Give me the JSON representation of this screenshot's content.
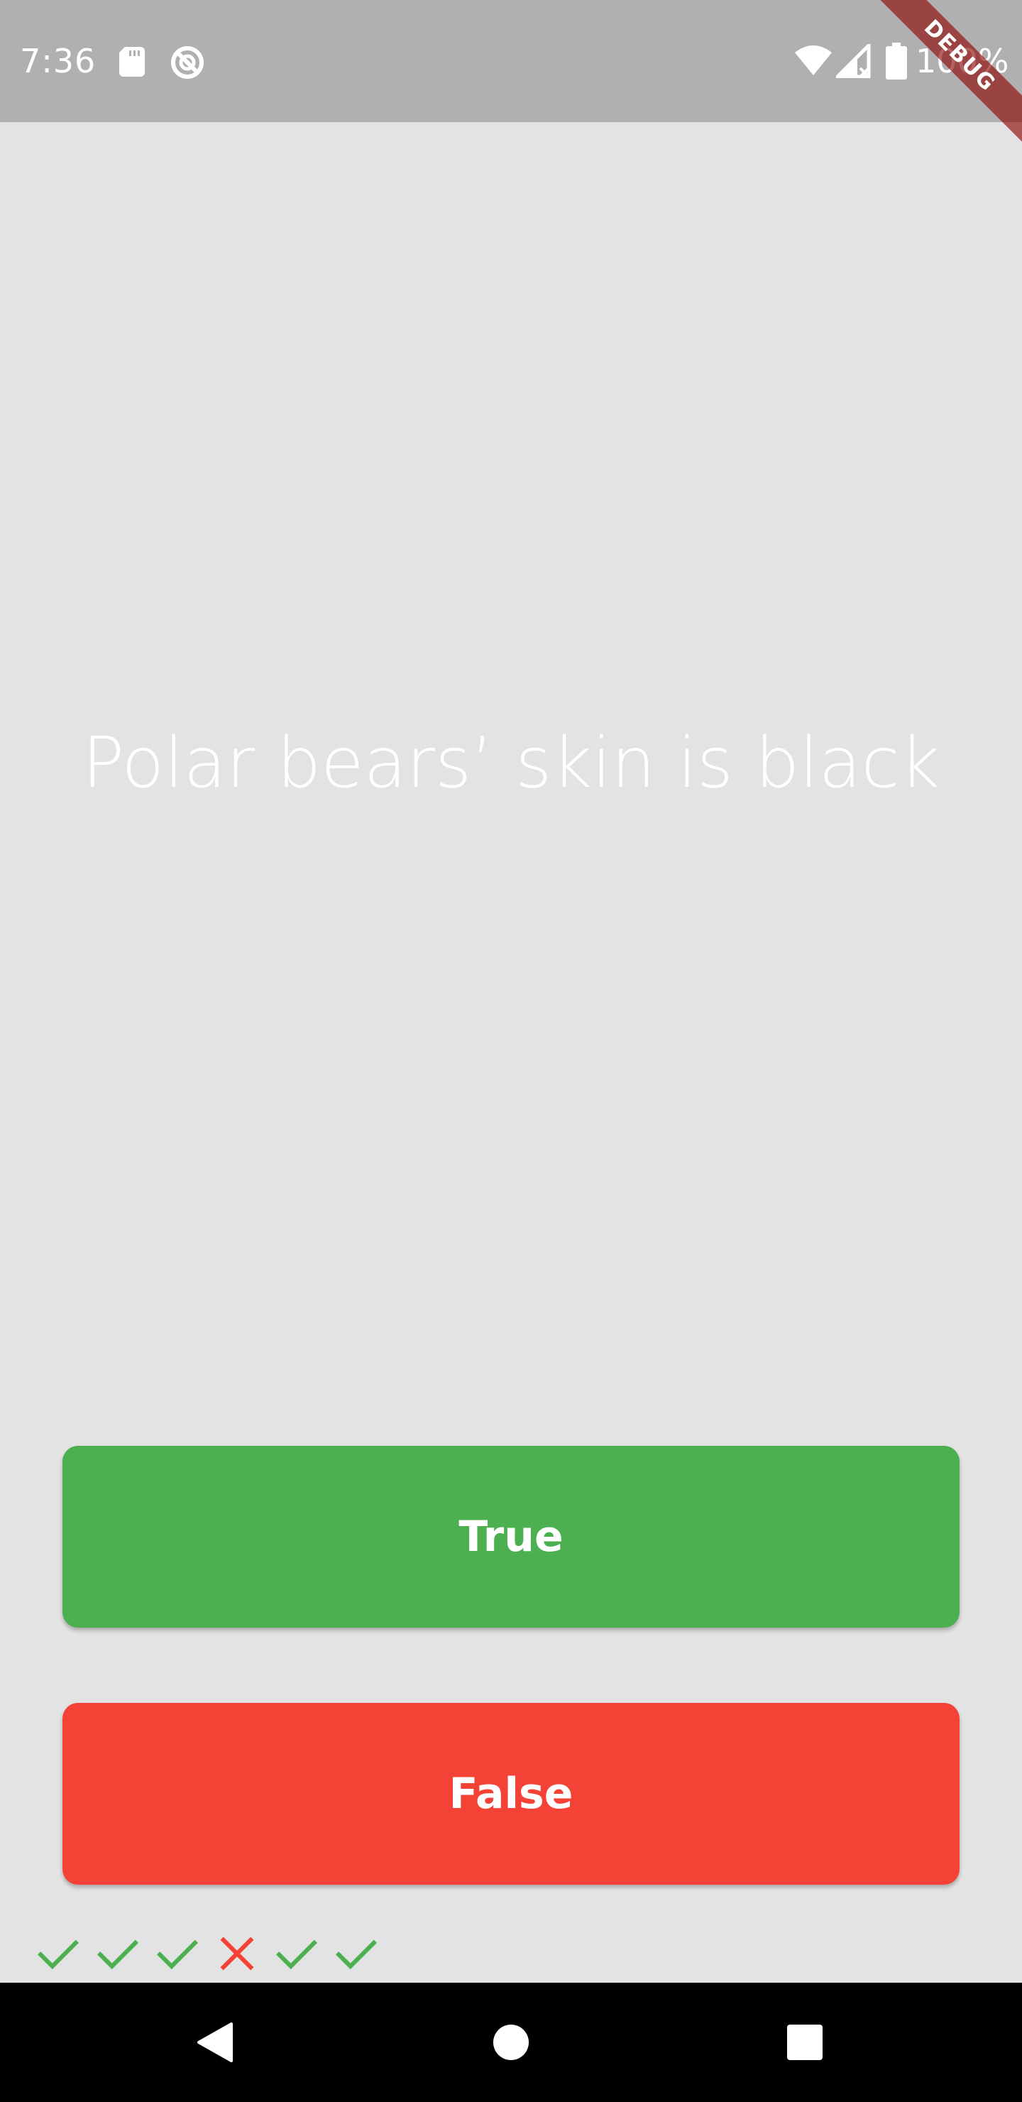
{
  "status_bar": {
    "time": "7:36",
    "battery": "100%",
    "icons": [
      "sd-card-icon",
      "sync-off-icon",
      "wifi-icon",
      "signal-icon",
      "battery-icon"
    ]
  },
  "debug_banner": "DEBUG",
  "question": {
    "text": "Polar bears’ skin is black"
  },
  "buttons": {
    "true_label": "True",
    "false_label": "False"
  },
  "score_keeper": [
    {
      "result": "correct",
      "icon": "check-icon"
    },
    {
      "result": "correct",
      "icon": "check-icon"
    },
    {
      "result": "correct",
      "icon": "check-icon"
    },
    {
      "result": "wrong",
      "icon": "close-icon"
    },
    {
      "result": "correct",
      "icon": "check-icon"
    },
    {
      "result": "correct",
      "icon": "check-icon"
    }
  ],
  "nav_bar": {
    "icons": [
      "back-icon",
      "home-icon",
      "recents-icon"
    ]
  },
  "colors": {
    "background": "#e3e3e3",
    "status_bar": "#b0b0b0",
    "true_button": "#4caf50",
    "false_button": "#f44336",
    "correct_mark": "#4caf50",
    "wrong_mark": "#f44336",
    "nav_bar": "#000000"
  }
}
